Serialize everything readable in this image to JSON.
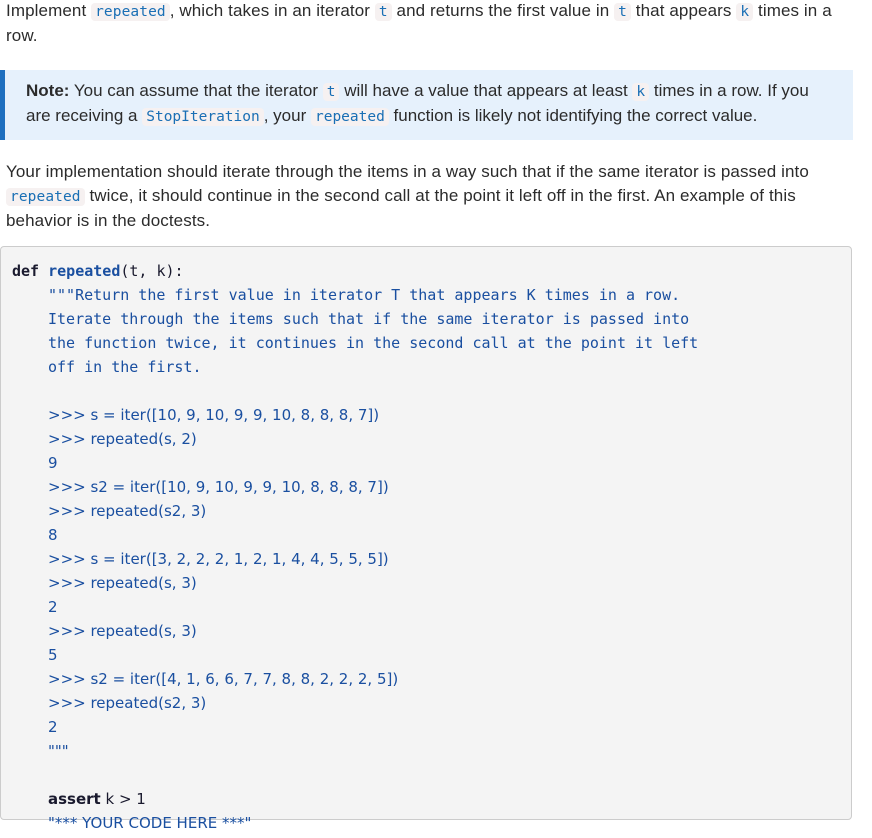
{
  "intro": {
    "parts": [
      "Implement ",
      "repeated",
      ", which takes in an iterator ",
      "t",
      " and returns the first value in ",
      "t",
      " that appears ",
      "k",
      " times in a row."
    ]
  },
  "note": {
    "label": "Note:",
    "parts": [
      " You can assume that the iterator ",
      "t",
      " will have a value that appears at least ",
      "k",
      " times in a row. If you are receiving a ",
      "StopIteration",
      ", your ",
      "repeated",
      " function is likely not identifying the correct value."
    ]
  },
  "behavior": {
    "parts": [
      "Your implementation should iterate through the items in a way such that if the same iterator is passed into ",
      "repeated",
      " twice, it should continue in the second call at the point it left off in the first. An example of this behavior is in the doctests."
    ]
  },
  "code": {
    "def_keyword": "def",
    "function_name": "repeated",
    "signature_rest": "(t, k):",
    "docstring": [
      "\"\"\"Return the first value in iterator T that appears K times in a row.",
      "Iterate through the items such that if the same iterator is passed into",
      "the function twice, it continues in the second call at the point it left",
      "off in the first."
    ],
    "doctests": [
      ">>> s = iter([10, 9, 10, 9, 9, 10, 8, 8, 8, 7])",
      ">>> repeated(s, 2)",
      "9",
      ">>> s2 = iter([10, 9, 10, 9, 9, 10, 8, 8, 8, 7])",
      ">>> repeated(s2, 3)",
      "8",
      ">>> s = iter([3, 2, 2, 2, 1, 2, 1, 4, 4, 5, 5, 5])",
      ">>> repeated(s, 3)",
      "2",
      ">>> repeated(s, 3)",
      "5",
      ">>> s2 = iter([4, 1, 6, 6, 7, 7, 8, 8, 2, 2, 2, 5])",
      ">>> repeated(s2, 3)",
      "2",
      "\"\"\""
    ],
    "assert_keyword": "assert",
    "assert_rest": " k > 1",
    "placeholder": "\"*** YOUR CODE HERE ***\""
  }
}
